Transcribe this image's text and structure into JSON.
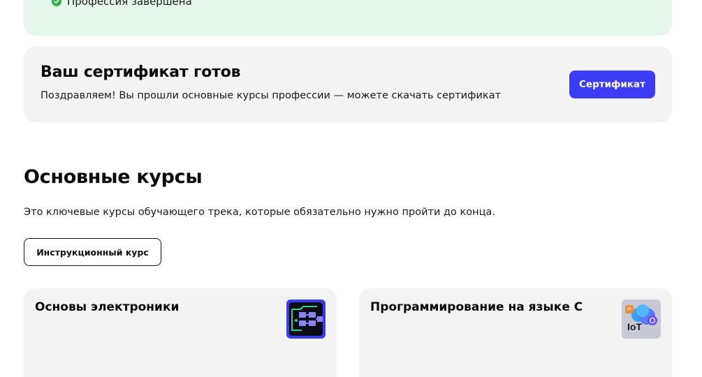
{
  "status_banner": {
    "text": "Профессия завершена",
    "icon": "check-circle-icon",
    "color": "#2cb24a",
    "background": "#e7f6ea"
  },
  "certificate": {
    "title": "Ваш сертификат готов",
    "description": "Поздравляем! Вы прошли основные курсы профессии — можете скачать сертификат",
    "button_label": "Сертификат",
    "button_color": "#3c3cf5"
  },
  "main_courses": {
    "title": "Основные курсы",
    "description": "Это ключевые курсы обучающего трека, которые обязательно нужно пройти до конца.",
    "filter_button_label": "Инструкционный курс",
    "courses": [
      {
        "title": "Основы электроники",
        "icon": "circuit-board-icon"
      },
      {
        "title": "Программирование на языке С",
        "icon": "iot-cloud-icon",
        "icon_label": "IoT"
      }
    ]
  }
}
